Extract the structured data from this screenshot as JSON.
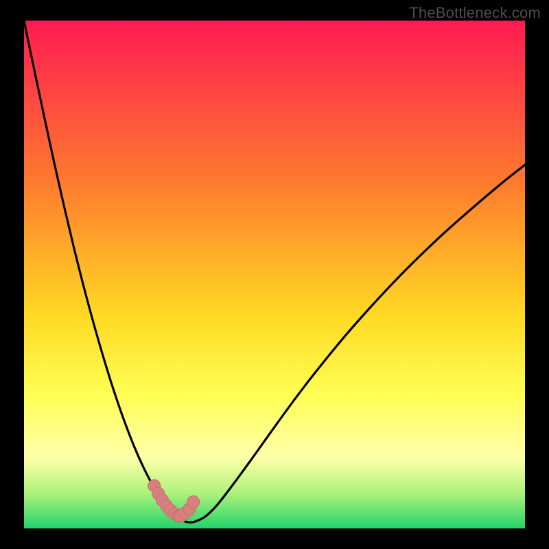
{
  "watermark": "TheBottleneck.com",
  "colors": {
    "bg": "#000000",
    "curve": "#000000",
    "marker_fill": "#d88080",
    "marker_stroke": "#c86e6e",
    "grad_top": "#ff1a52",
    "grad_mid1": "#ff7b2e",
    "grad_mid2": "#ffd923",
    "grad_yellow": "#ffff55",
    "grad_pale": "#feffa9",
    "grad_green1": "#aef27a",
    "grad_green2": "#23d36b"
  },
  "chart_data": {
    "type": "line",
    "title": "",
    "xlabel": "",
    "ylabel": "",
    "xlim": [
      0,
      100
    ],
    "ylim": [
      0,
      100
    ],
    "x": [
      0,
      2,
      4,
      6,
      8,
      10,
      12,
      14,
      16,
      18,
      20,
      22,
      24,
      26,
      27,
      28,
      29,
      30,
      31,
      32,
      33,
      34,
      36,
      38,
      40,
      44,
      48,
      52,
      56,
      60,
      64,
      68,
      72,
      76,
      80,
      84,
      88,
      92,
      96,
      100
    ],
    "values": [
      100,
      90.5,
      81.2,
      72.1,
      63.4,
      55.1,
      47.3,
      40.0,
      33.2,
      26.9,
      21.2,
      16.1,
      11.7,
      7.9,
      6.2,
      4.8,
      3.6,
      2.6,
      1.9,
      1.4,
      1.2,
      1.3,
      2.2,
      4.0,
      6.4,
      11.7,
      17.2,
      22.7,
      28.0,
      33.0,
      37.8,
      42.3,
      46.6,
      50.7,
      54.6,
      58.3,
      61.8,
      65.2,
      68.5,
      71.6
    ],
    "markers": {
      "x": [
        26.0,
        26.8,
        27.6,
        28.4,
        29.2,
        30.0,
        30.8,
        31.0,
        31.4,
        32.0,
        33.0,
        33.8
      ],
      "y": [
        8.4,
        6.9,
        5.6,
        4.5,
        3.6,
        2.9,
        2.5,
        2.4,
        2.5,
        2.9,
        3.8,
        5.2
      ]
    }
  }
}
